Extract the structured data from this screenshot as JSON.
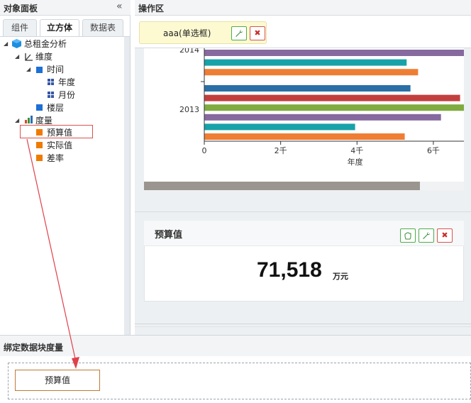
{
  "left_panel": {
    "title": "对象面板",
    "collapse_glyph": "«",
    "tabs": [
      "组件",
      "立方体",
      "数据表"
    ],
    "active_tab": "立方体",
    "tree": {
      "root": "总租金分析",
      "dimensions": "维度",
      "time": "时间",
      "year": "年度",
      "month": "月份",
      "floor": "楼层",
      "measures": "度量",
      "m1": "预算值",
      "m2": "实际值",
      "m3": "差率"
    }
  },
  "op_area": {
    "title": "操作区",
    "selector_label": "aaa(单选框)",
    "icons": {
      "wrench": "wrench-icon",
      "close": "close-icon",
      "hand": "hand-icon"
    }
  },
  "chart_data": {
    "type": "bar",
    "orientation": "horizontal",
    "xlabel": "年度",
    "ylabel": "",
    "x_ticks": [
      "0",
      "2千",
      "4千",
      "6千"
    ],
    "xlim": [
      0,
      6800
    ],
    "categories": [
      "2014",
      "2013"
    ],
    "groups": [
      {
        "label": "2014",
        "values": [
          6800,
          5300,
          5600
        ],
        "colors": [
          "#86699e",
          "#16a2a8",
          "#ef7e35"
        ]
      },
      {
        "label": "2013",
        "values": [
          5400,
          6700,
          6800,
          6200,
          3950,
          5250
        ],
        "colors": [
          "#2a70a6",
          "#c1403e",
          "#7fab3f",
          "#86699e",
          "#16a2a8",
          "#ef7e35"
        ]
      }
    ]
  },
  "kpi": {
    "title": "预算值",
    "value": "71,518",
    "unit": "万元"
  },
  "bind_panel": {
    "title": "绑定数据块度量",
    "chip_label": "预算值"
  },
  "colors": {
    "accent_green": "#4cae4c",
    "accent_red": "#d9534f",
    "highlight_border": "#d9534f",
    "arrow": "#e0404a"
  }
}
